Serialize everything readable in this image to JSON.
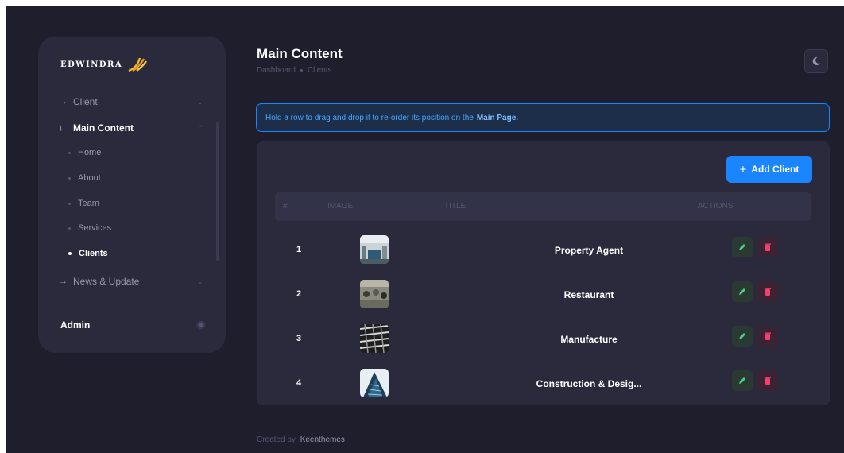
{
  "brand": {
    "name": "EDWINDRA"
  },
  "sidebar": {
    "items": [
      {
        "label": "Client"
      },
      {
        "label": "Main Content"
      },
      {
        "label": "News & Update"
      }
    ],
    "sub_items": [
      {
        "label": "Home"
      },
      {
        "label": "About"
      },
      {
        "label": "Team"
      },
      {
        "label": "Services"
      },
      {
        "label": "Clients"
      }
    ],
    "admin_label": "Admin"
  },
  "header": {
    "title": "Main Content",
    "breadcrumb": [
      "Dashboard",
      "Clients"
    ]
  },
  "notice": {
    "text": "Hold a row to drag and drop it to re-order its position on the",
    "link": "Main Page."
  },
  "toolbar": {
    "add_label": "Add Client"
  },
  "table": {
    "columns": [
      "#",
      "IMAGE",
      "TITLE",
      "ACTIONS"
    ],
    "rows": [
      {
        "num": "1",
        "title": "Property Agent"
      },
      {
        "num": "2",
        "title": "Restaurant"
      },
      {
        "num": "3",
        "title": "Manufacture"
      },
      {
        "num": "4",
        "title": "Construction & Desig..."
      }
    ]
  },
  "footer": {
    "prefix": "Created by",
    "link": "Keenthemes"
  },
  "colors": {
    "background": "#1e1e2d",
    "card": "#2a2a3c",
    "accent": "#1b84ff",
    "success": "#50cd89",
    "danger": "#f1416c"
  }
}
